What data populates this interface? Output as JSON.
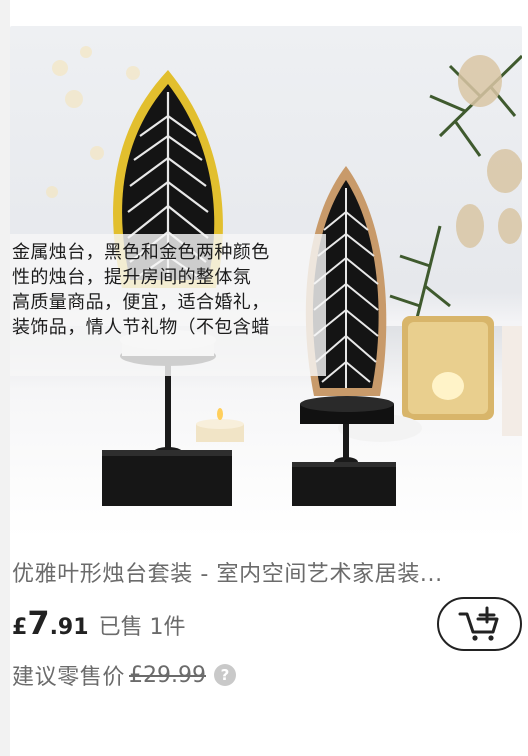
{
  "overlay": {
    "lines": [
      "金属烛台，黑色和金色两种颜色",
      "性的烛台，提升房间的整体氛",
      "高质量商品，便宜，适合婚礼，",
      "装饰品，情人节礼物（不包含蜡"
    ]
  },
  "product": {
    "title": "优雅叶形烛台套装 - 室内空间艺术家居装...",
    "price_currency": "£",
    "price_major": "7",
    "price_minor": ".91",
    "sold_text": "已售 1件",
    "rrp_label": "建议零售价",
    "rrp_price": "£29.99",
    "help_glyph": "?"
  },
  "icons": {
    "cart": "add-to-cart-icon",
    "help": "question-mark-icon"
  },
  "colors": {
    "text_primary": "#222222",
    "text_secondary": "#6b6b6b",
    "leaf_gold": "#e2bf2e",
    "leaf_copper": "#c89a6a",
    "metal_black": "#1a1a1a"
  }
}
